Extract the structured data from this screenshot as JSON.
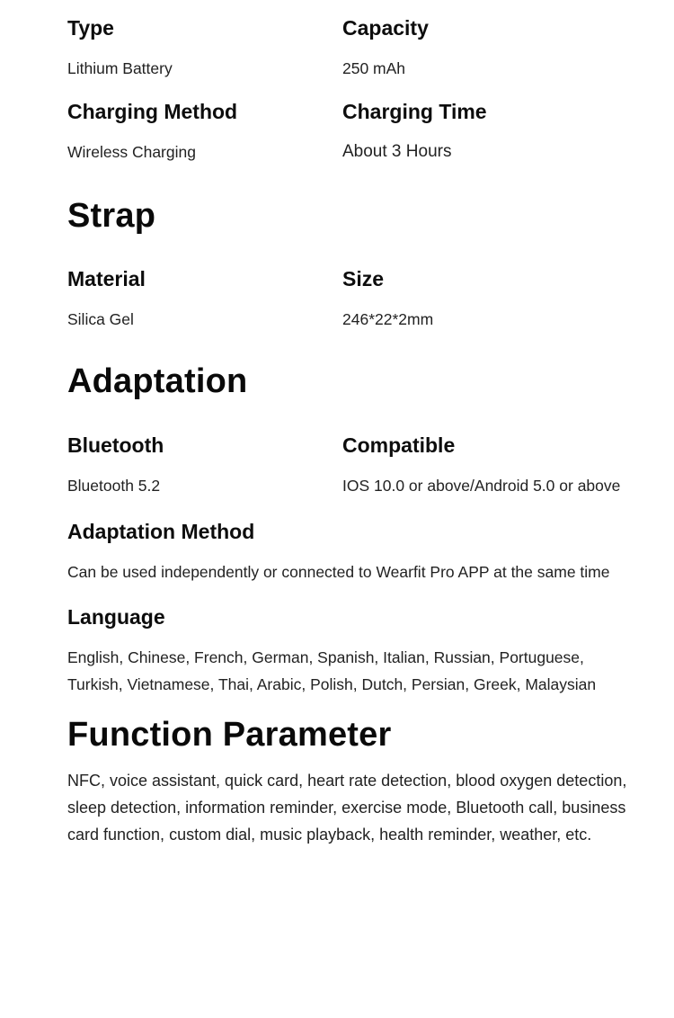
{
  "battery": {
    "fields": [
      {
        "label": "Type",
        "value": "Lithium Battery"
      },
      {
        "label": "Capacity",
        "value": "250 mAh"
      },
      {
        "label": "Charging Method",
        "value": "Wireless Charging"
      },
      {
        "label": "Charging Time",
        "value": "About 3 Hours"
      }
    ]
  },
  "strap": {
    "title": "Strap",
    "fields": [
      {
        "label": "Material",
        "value": "Silica Gel"
      },
      {
        "label": "Size",
        "value": "246*22*2mm"
      }
    ]
  },
  "adaptation": {
    "title": "Adaptation",
    "fields": [
      {
        "label": "Bluetooth",
        "value": "Bluetooth 5.2"
      },
      {
        "label": "Compatible",
        "value": "IOS 10.0 or above/Android 5.0 or above"
      },
      {
        "label": "Adaptation Method",
        "value": "Can be used independently or connected to Wearfit Pro APP at the same time"
      }
    ],
    "language": {
      "label": "Language",
      "lines": [
        "English, Chinese, French, German, Spanish, Italian, Russian, Portuguese,",
        "Turkish, Vietnamese, Thai, Arabic, Polish, Dutch, Persian, Greek, Malaysian"
      ]
    }
  },
  "function_parameter": {
    "title": "Function Parameter",
    "lines": [
      "NFC, voice assistant, quick card, heart rate detection, blood oxygen detection,",
      "sleep detection, information reminder, exercise mode, Bluetooth call, business",
      "card function, custom dial, music playback, health reminder, weather, etc."
    ]
  }
}
